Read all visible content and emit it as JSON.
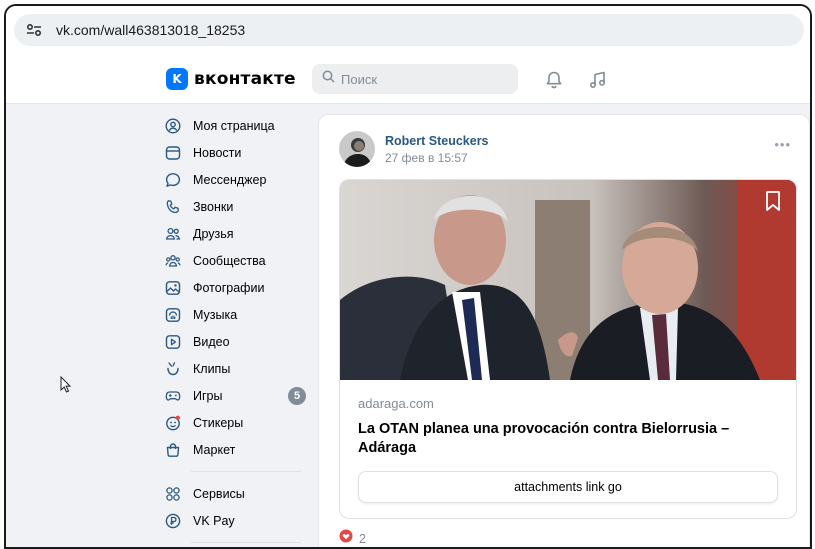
{
  "browser": {
    "url": "vk.com/wall463813018_18253"
  },
  "header": {
    "logo_badge": "K",
    "logo_text": "вконтакте",
    "search_placeholder": "Поиск",
    "brand_color": "#0077ff"
  },
  "sidebar": {
    "items": [
      {
        "label": "Моя страница",
        "icon": "user-circle-icon"
      },
      {
        "label": "Новости",
        "icon": "news-icon"
      },
      {
        "label": "Мессенджер",
        "icon": "message-icon"
      },
      {
        "label": "Звонки",
        "icon": "phone-icon"
      },
      {
        "label": "Друзья",
        "icon": "friends-icon"
      },
      {
        "label": "Сообщества",
        "icon": "communities-icon"
      },
      {
        "label": "Фотографии",
        "icon": "photo-icon"
      },
      {
        "label": "Музыка",
        "icon": "music-icon"
      },
      {
        "label": "Видео",
        "icon": "video-icon"
      },
      {
        "label": "Клипы",
        "icon": "clips-icon"
      },
      {
        "label": "Игры",
        "icon": "games-icon",
        "counter": "5"
      },
      {
        "label": "Стикеры",
        "icon": "stickers-icon"
      },
      {
        "label": "Маркет",
        "icon": "market-icon"
      }
    ],
    "secondary_items": [
      {
        "label": "Сервисы",
        "icon": "services-icon"
      },
      {
        "label": "VK Pay",
        "icon": "vkpay-icon"
      }
    ]
  },
  "post": {
    "author": "Robert Steuckers",
    "time": "27 фев в 15:57",
    "more": "•••",
    "link": {
      "domain": "adaraga.com",
      "title": "La OTAN planea una provocación contra Bielorrusia – Adáraga",
      "button_label": "attachments link go"
    },
    "likes": "2"
  }
}
